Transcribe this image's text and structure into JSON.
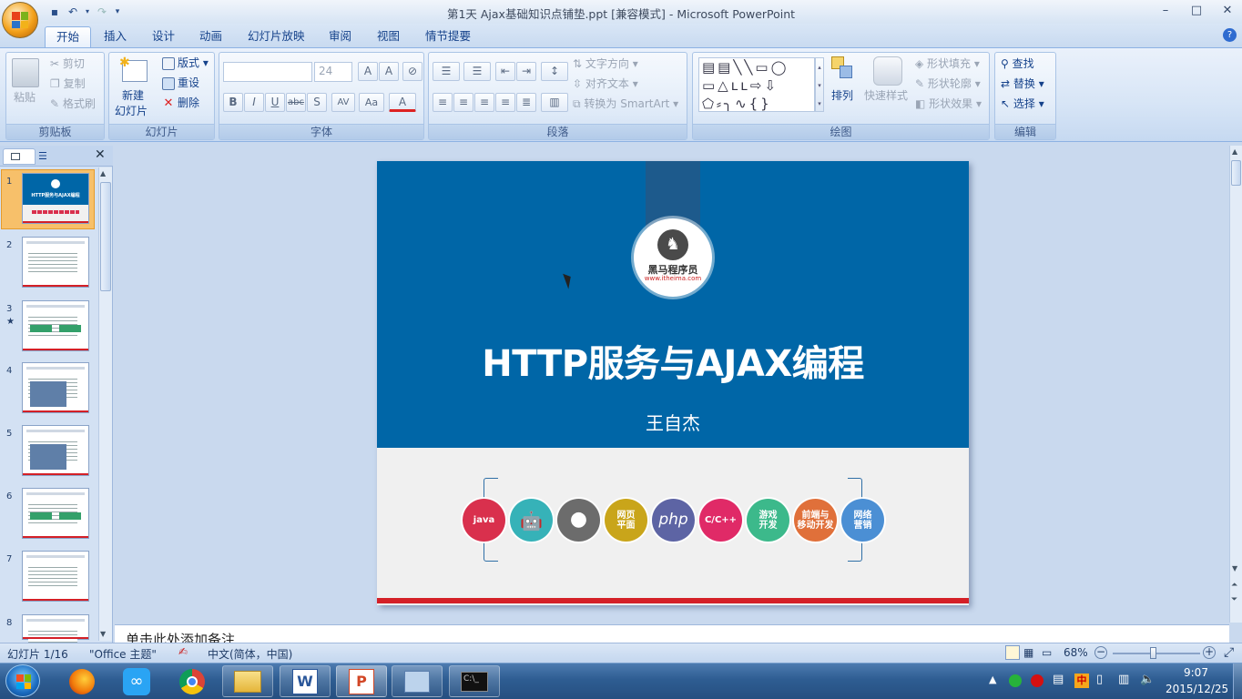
{
  "window": {
    "title": "第1天 Ajax基础知识点铺垫.ppt [兼容模式] - Microsoft PowerPoint",
    "minimize": "–",
    "maximize": "□",
    "close": "✕"
  },
  "tabs": [
    "开始",
    "插入",
    "设计",
    "动画",
    "幻灯片放映",
    "审阅",
    "视图",
    "情节提要"
  ],
  "ribbon": {
    "clipboard": {
      "title": "剪贴板",
      "paste": "粘贴",
      "cut": "剪切",
      "copy": "复制",
      "format_painter": "格式刷"
    },
    "slides": {
      "title": "幻灯片",
      "new_slide_1": "新建",
      "new_slide_2": "幻灯片",
      "layout": "版式",
      "reset": "重设",
      "delete": "删除"
    },
    "font": {
      "title": "字体",
      "size": "24"
    },
    "paragraph": {
      "title": "段落",
      "text_direction": "文字方向",
      "align_text": "对齐文本",
      "smartart": "转换为 SmartArt"
    },
    "drawing": {
      "title": "绘图",
      "arrange": "排列",
      "quick_styles": "快速样式",
      "shape_fill": "形状填充",
      "shape_outline": "形状轮廓",
      "shape_effects": "形状效果"
    },
    "editing": {
      "title": "编辑",
      "find": "查找",
      "replace": "替换",
      "select": "选择"
    }
  },
  "thumbnails": [
    {
      "num": "1",
      "title": "HTTP服务与AJAX编程"
    },
    {
      "num": "2"
    },
    {
      "num": "3",
      "mark": "★"
    },
    {
      "num": "4"
    },
    {
      "num": "5"
    },
    {
      "num": "6"
    },
    {
      "num": "7"
    },
    {
      "num": "8"
    }
  ],
  "slide": {
    "logo_name": "黑马程序员",
    "logo_url": "www.itheima.com",
    "title": "HTTP服务与AJAX编程",
    "author": "王自杰",
    "icons": [
      {
        "label": "java",
        "color": "#d9304d"
      },
      {
        "label": "",
        "color": "#36b2b8"
      },
      {
        "label": "",
        "color": "#6c6c6c"
      },
      {
        "label": "网页\n平面",
        "color": "#c9a51a"
      },
      {
        "label": "php",
        "color": "#5d64a4"
      },
      {
        "label": "C/C++",
        "color": "#e02a67"
      },
      {
        "label": "游戏\n开发",
        "color": "#3cb98b"
      },
      {
        "label": "前端与\n移动开发",
        "color": "#e0703a"
      },
      {
        "label": "网络\n营销",
        "color": "#4b8fd4"
      }
    ]
  },
  "notes_placeholder": "单击此处添加备注",
  "status": {
    "slide_counter": "幻灯片 1/16",
    "theme": "\"Office 主题\"",
    "language": "中文(简体，中国)",
    "zoom": "68%",
    "zoom_level": 0.68
  },
  "taskbar": {
    "time": "9:07",
    "date": "2015/12/25",
    "ime": "中"
  }
}
